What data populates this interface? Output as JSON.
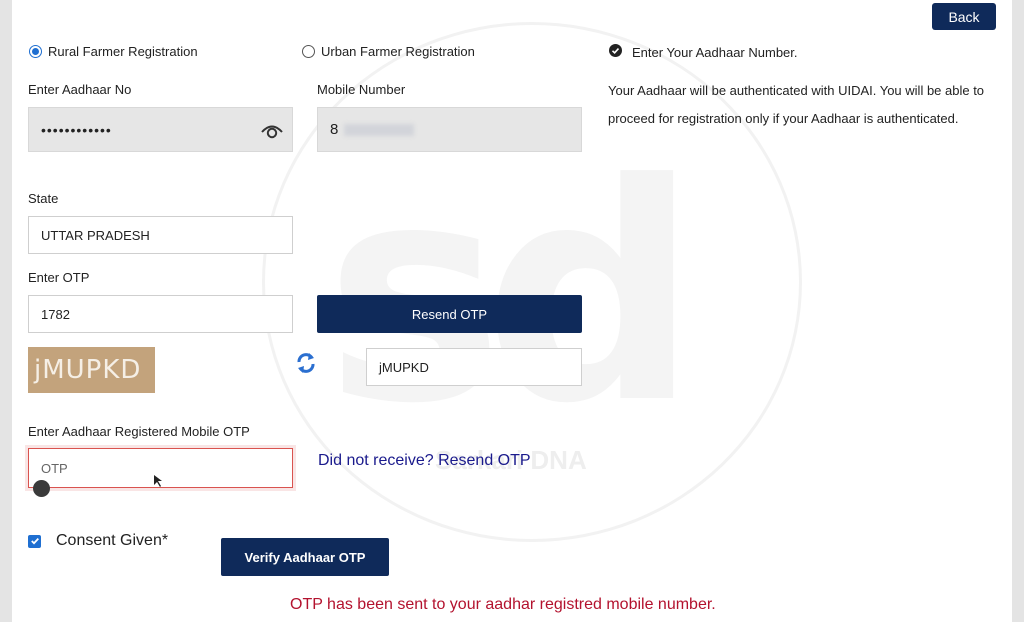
{
  "header": {
    "back_label": "Back"
  },
  "registration_type": {
    "rural_label": "Rural Farmer Registration",
    "urban_label": "Urban Farmer Registration",
    "selected": "rural"
  },
  "aadhaar": {
    "label": "Enter Aadhaar No",
    "value": "••••••••••••",
    "icon": "eye-icon"
  },
  "mobile": {
    "label": "Mobile Number",
    "value": "8"
  },
  "state": {
    "label": "State",
    "value": "UTTAR PRADESH"
  },
  "otp": {
    "label": "Enter OTP",
    "value": "1782",
    "resend_label": "Resend OTP"
  },
  "captcha": {
    "image_text": "jMUPKD",
    "input_value": "jMUPKD",
    "refresh_icon": "refresh-icon"
  },
  "aadhaar_otp": {
    "label": "Enter Aadhaar Registered Mobile OTP",
    "placeholder": "OTP",
    "resend_link": "Did not receive? Resend OTP"
  },
  "consent": {
    "label": "Consent Given*",
    "checked": true
  },
  "verify_button": "Verify Aadhaar OTP",
  "status_message": "OTP has been sent to your aadhar registred mobile number.",
  "info_panel": {
    "title": "Enter Your Aadhaar Number.",
    "body": "Your Aadhaar will be authenticated with UIDAI. You will be able to proceed for registration only if your Aadhaar is authenticated."
  },
  "watermark": {
    "letters": "sd",
    "text": "Sarkari DNA"
  },
  "colors": {
    "primary": "#0f2a5a",
    "error": "#b3122e",
    "link": "#1a1a8c",
    "checkbox": "#1f6fd1"
  }
}
